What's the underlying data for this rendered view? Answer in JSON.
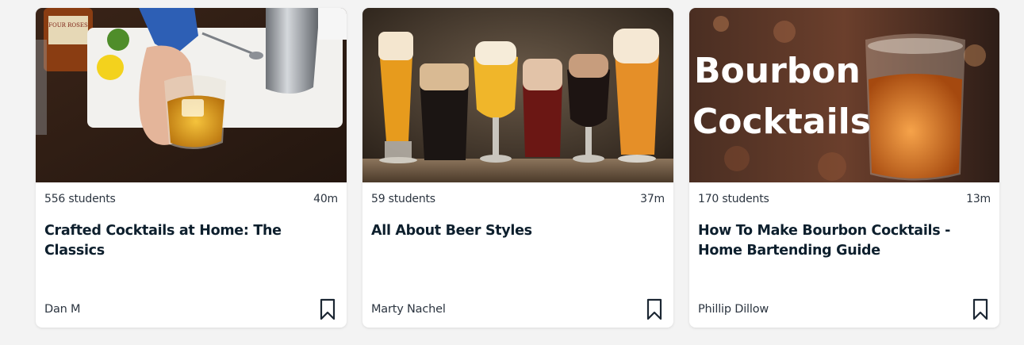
{
  "courses": [
    {
      "students": "556 students",
      "duration": "40m",
      "title": "Crafted Cocktails at Home: The Classics",
      "author": "Dan M"
    },
    {
      "students": "59 students",
      "duration": "37m",
      "title": "All About Beer Styles",
      "author": "Marty Nachel"
    },
    {
      "students": "170 students",
      "duration": "13m",
      "title": "How To Make Bourbon Cocktails - Home Bartending Guide",
      "author": "Phillip Dillow",
      "thumbnail_text_line1": "Bourbon",
      "thumbnail_text_line2": "Cocktails"
    }
  ],
  "thumbnail_1_label_text": "FOUR ROSES"
}
